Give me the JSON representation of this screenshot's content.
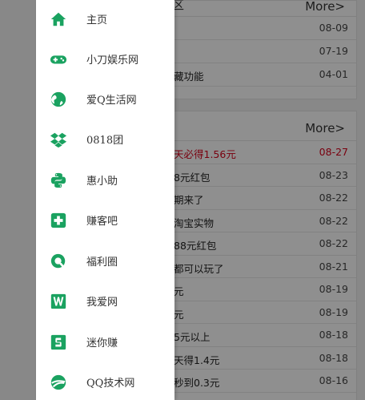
{
  "accent_color": "#1aa260",
  "background_page": {
    "card_top": {
      "title": "区",
      "more_label": "More>",
      "rows": [
        {
          "text": "",
          "date": "08-09"
        },
        {
          "text": "",
          "date": "07-19"
        },
        {
          "text": "藏功能",
          "date": "04-01"
        }
      ]
    },
    "card_bottom": {
      "title": "",
      "more_label": "More>",
      "rows": [
        {
          "text": "天必得1.56元",
          "date": "08-27",
          "highlight": true
        },
        {
          "text": "8元红包",
          "date": "08-23"
        },
        {
          "text": "期来了",
          "date": "08-22"
        },
        {
          "text": "淘宝实物",
          "date": "08-22"
        },
        {
          "text": "88元红包",
          "date": "08-22"
        },
        {
          "text": "都可以玩了",
          "date": "08-21"
        },
        {
          "text": "元",
          "date": "08-19"
        },
        {
          "text": "元",
          "date": "08-19"
        },
        {
          "text": "5元以上",
          "date": "08-18"
        },
        {
          "text": "天得1.4元",
          "date": "08-18"
        },
        {
          "text": "秒到0.3元",
          "date": "08-16"
        }
      ]
    }
  },
  "drawer": {
    "items": [
      {
        "label": "主页",
        "icon": "home-icon"
      },
      {
        "label": "小刀娱乐网",
        "icon": "gamepad-icon"
      },
      {
        "label": "爱Q生活网",
        "icon": "globe-icon"
      },
      {
        "label": "0818团",
        "icon": "dropbox-icon"
      },
      {
        "label": "惠小助",
        "icon": "python-icon"
      },
      {
        "label": "赚客吧",
        "icon": "medical-cross-icon"
      },
      {
        "label": "福利圈",
        "icon": "q-circle-icon"
      },
      {
        "label": "我爱网",
        "icon": "w-square-icon"
      },
      {
        "label": "迷你赚",
        "icon": "s-square-icon"
      },
      {
        "label": "QQ技术网",
        "icon": "road-globe-icon"
      }
    ]
  }
}
